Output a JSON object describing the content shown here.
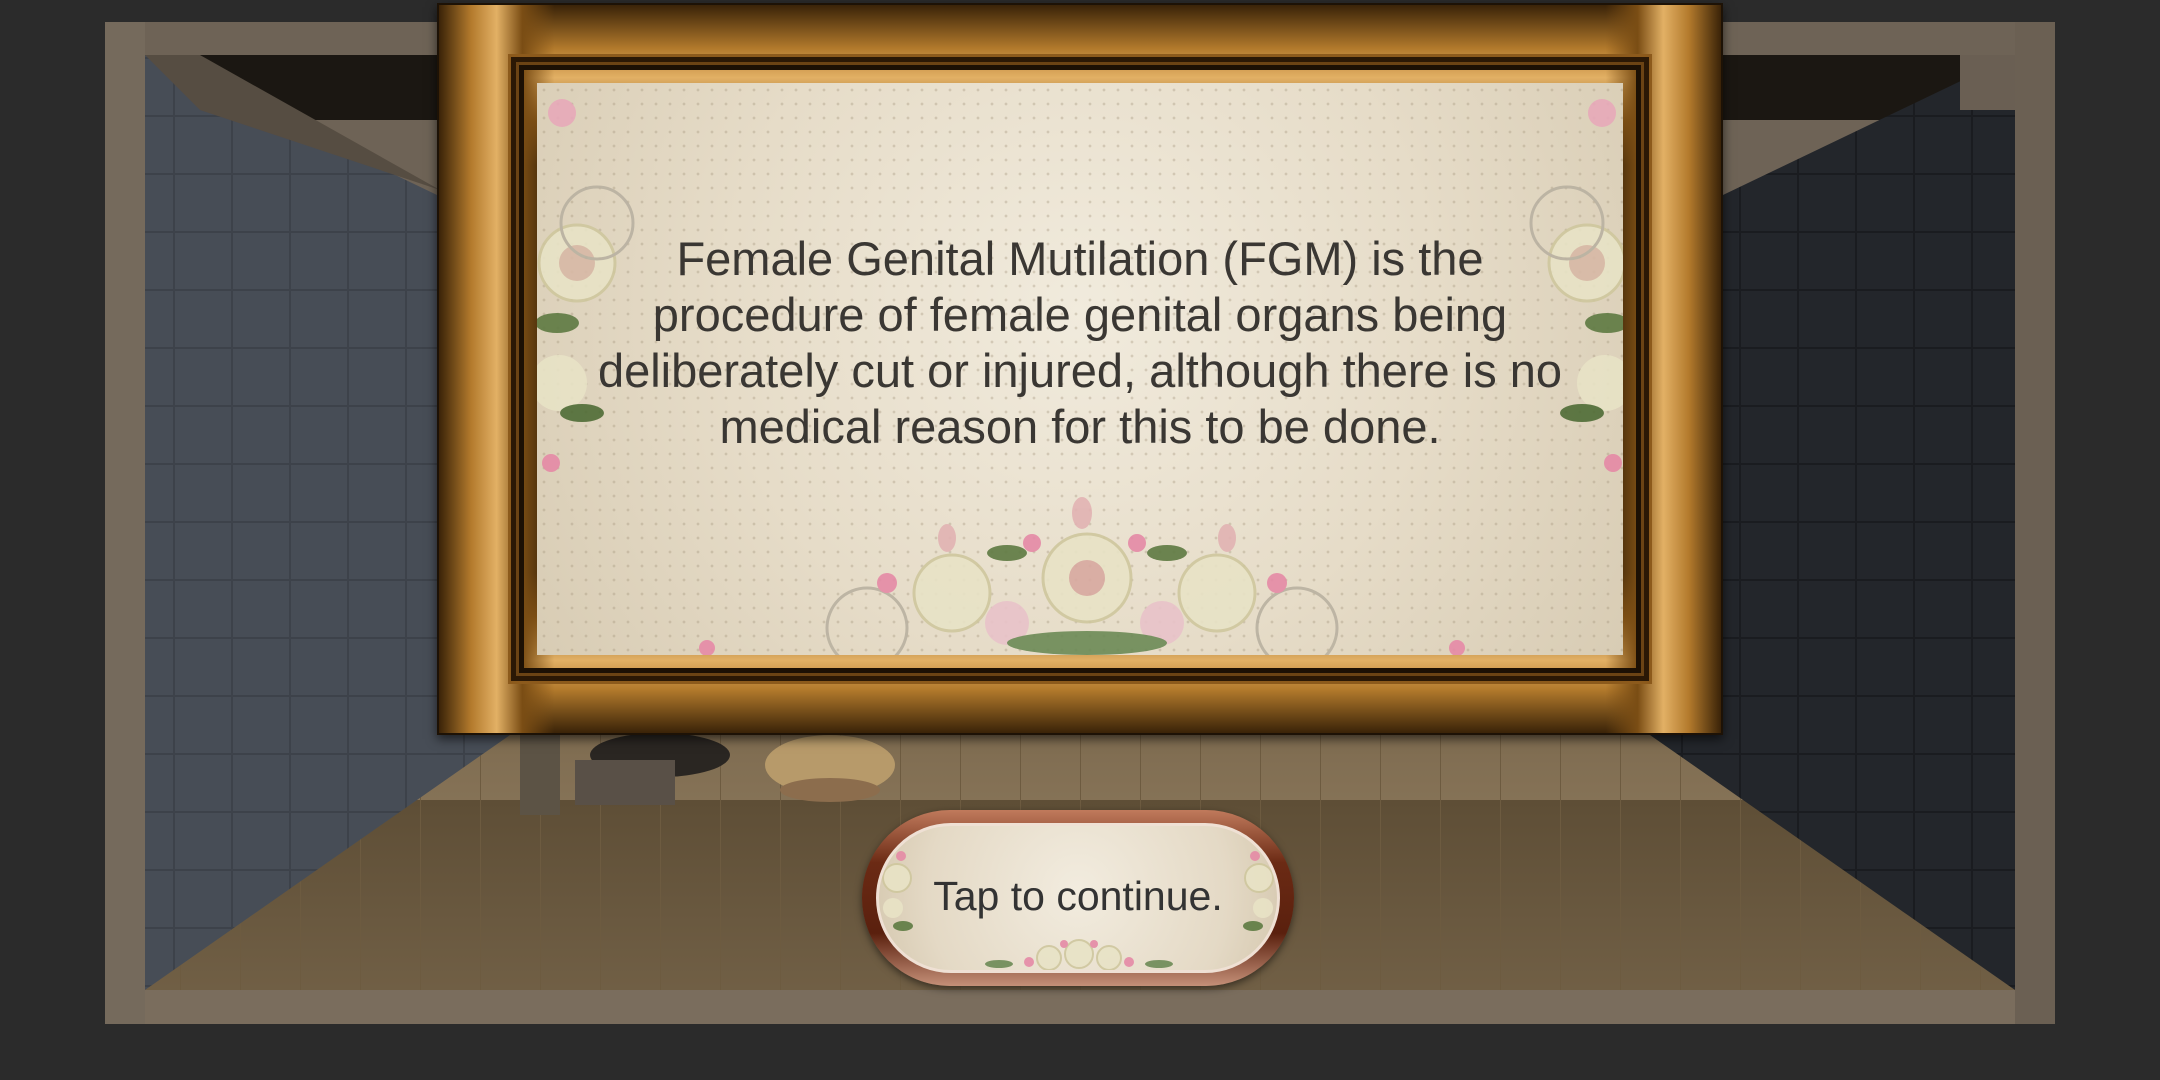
{
  "scene": {
    "info_panel": {
      "text": "Female Genital Mutilation (FGM) is the procedure of female genital organs being deliberately cut or injured, although there is no medical reason for this to be done."
    },
    "continue_button": {
      "label": "Tap to continue."
    },
    "colors": {
      "background": "#2b2b2b",
      "frame_gold": "#b37a2c",
      "canvas": "#e6dcc8",
      "button_rim": "#6b2a14",
      "text": "#3a3733"
    },
    "icons": [
      "floral-decoration-icon",
      "clock-ornament-icon"
    ]
  }
}
